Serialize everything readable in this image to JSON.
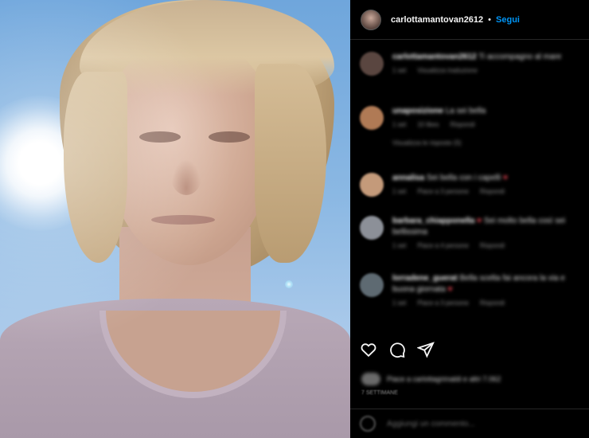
{
  "post": {
    "username": "carlottamantovan2612",
    "separator": "•",
    "follow_label": "Segui"
  },
  "comments": [
    {
      "user": "carlottamantovan2612",
      "text": "Ti accompagno al mare",
      "meta": [
        "1 set",
        "Visualizza traduzione"
      ],
      "avatar_color": "#5a4640"
    },
    {
      "user": "unaposizione",
      "text": "La sei bella",
      "meta": [
        "1 set",
        "10 likes",
        "Rispondi"
      ],
      "avatar_color": "#b07a55"
    },
    {
      "user": "",
      "text": "",
      "meta": [
        "Visualizza le risposte (5)"
      ],
      "avatar_color": "#000000"
    },
    {
      "user": "annalisa",
      "text": "Sei bella con i capelli",
      "meta": [
        "1 set",
        "Piace a 3 persone",
        "Rispondi"
      ],
      "avatar_color": "#c49a7a",
      "heart": "♥"
    },
    {
      "user": "barbara_chiapponella",
      "text": "Sei molto bella così sei bellissima",
      "meta": [
        "1 set",
        "Piace a 4 persone",
        "Rispondi"
      ],
      "avatar_color": "#8c9098",
      "heart": "♥"
    },
    {
      "user": "lorradene_guerat",
      "text": "Bella scelta fai ancora la via e buona giornata",
      "meta": [
        "1 set",
        "Piace a 3 persone",
        "Rispondi"
      ],
      "avatar_color": "#5e6a72",
      "heart": "♥"
    }
  ],
  "likes": {
    "text": "Piace a carlottagrimaldi e altri 7.062"
  },
  "date": "7 SETTIMANE",
  "add_comment": {
    "placeholder": "Aggiungi un commento..."
  },
  "icons": {
    "like": "heart-icon",
    "comment": "comment-icon",
    "share": "share-icon",
    "emoji": "emoji-icon"
  },
  "colors": {
    "accent": "#0095f6",
    "background": "#000000"
  }
}
